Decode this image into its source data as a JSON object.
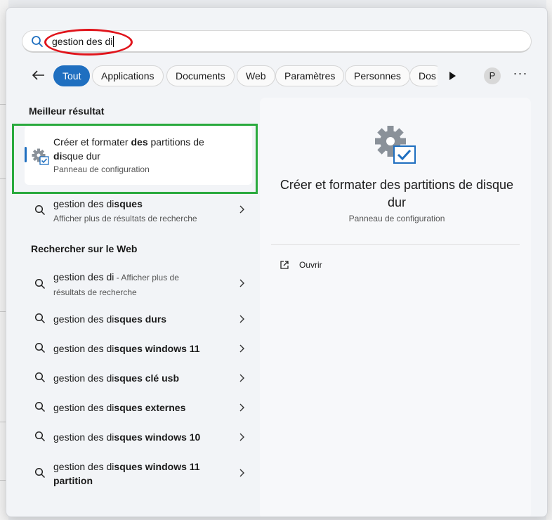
{
  "search": {
    "query": "gestion des di"
  },
  "filters": {
    "chips": [
      "Tout",
      "Applications",
      "Documents",
      "Web",
      "Paramètres",
      "Personnes"
    ],
    "overflow_chip": "Dos",
    "avatar_initial": "P",
    "more_label": "···"
  },
  "best_match": {
    "heading": "Meilleur résultat",
    "title_normal_1": "Créer et formater ",
    "title_bold_1": "des",
    "title_normal_2": " partitions de ",
    "title_bold_2": "di",
    "title_normal_3": "sque dur",
    "subtitle": "Panneau de configuration"
  },
  "app_result": {
    "prefix": "gestion des di",
    "suffix": "sques",
    "subtitle": "Afficher plus de résultats de recherche"
  },
  "web": {
    "heading": "Rechercher sur le Web",
    "first": {
      "query": "gestion des di",
      "hint": " - Afficher plus de résultats de recherche"
    },
    "suggestions": [
      {
        "prefix": "gestion des di",
        "suffix": "sques durs"
      },
      {
        "prefix": "gestion des di",
        "suffix": "sques windows 11"
      },
      {
        "prefix": "gestion des di",
        "suffix": "sques clé usb"
      },
      {
        "prefix": "gestion des di",
        "suffix": "sques externes"
      },
      {
        "prefix": "gestion des di",
        "suffix": "sques windows 10"
      },
      {
        "prefix": "gestion des di",
        "suffix": "sques windows 11 partition"
      }
    ]
  },
  "detail": {
    "title": "Créer et formater des partitions de disque dur",
    "subtitle": "Panneau de configuration",
    "action_open": "Ouvrir"
  },
  "colors": {
    "accent": "#1f6fc0",
    "annotation_red": "#e0141b",
    "annotation_green": "#2aaa3e"
  }
}
